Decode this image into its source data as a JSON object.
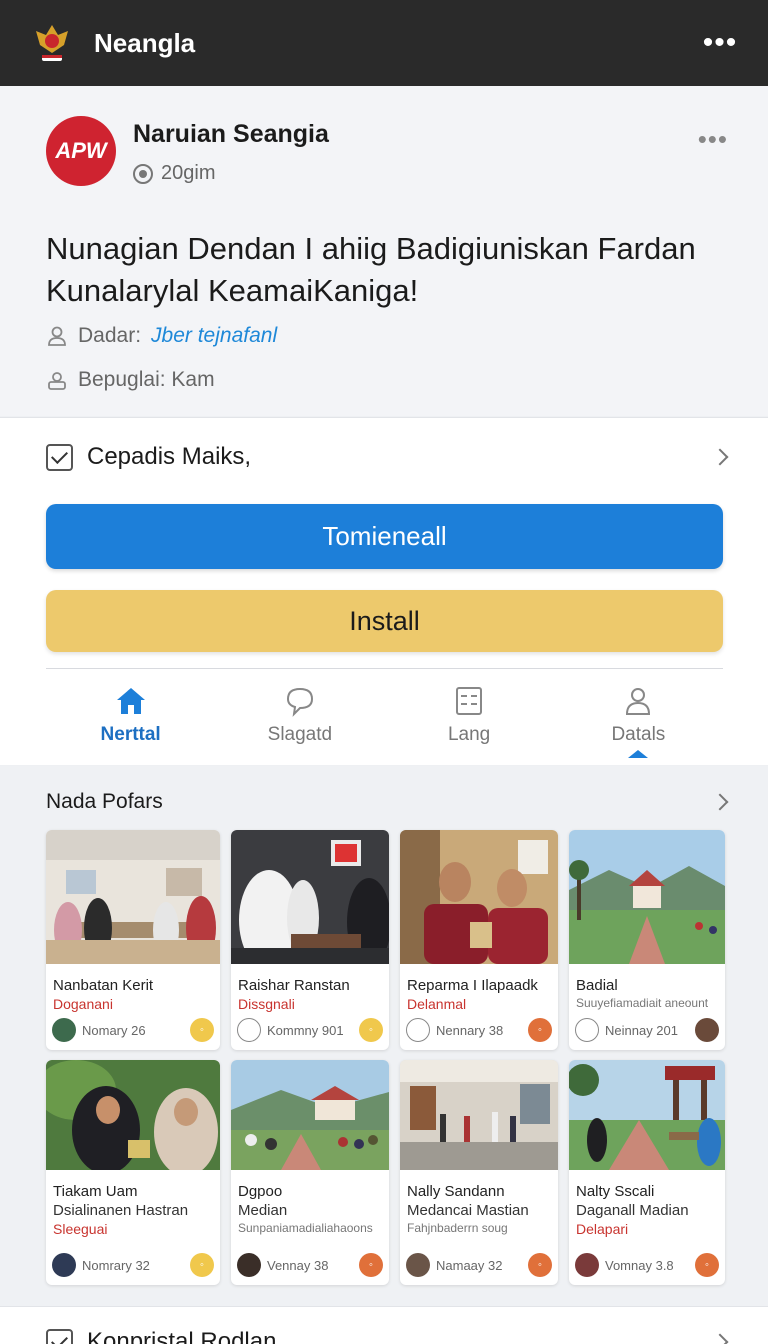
{
  "topbar": {
    "title": "Neangla",
    "more_icon": "more-horizontal-icon"
  },
  "post": {
    "badge": "APW",
    "author": "Naruian Seangia",
    "time": "20gim",
    "headline": "Nunagian Dendan I ahiig Badigiuniskan Fardan Kunalarylal KeamaiKaniga!",
    "meta1_label": "Dadar:",
    "meta1_link": "Jber tejnafanl",
    "meta2": "Bepuglai: Kam"
  },
  "actions": {
    "check_label": "Cepadis Maiks,",
    "primary_label": "Tomieneall",
    "secondary_label": "Install",
    "colors": {
      "primary": "#1d7fd9",
      "secondary": "#edc96c"
    }
  },
  "tabs": [
    {
      "label": "Nerttal",
      "icon": "home-icon",
      "active": true
    },
    {
      "label": "Slagatd",
      "icon": "chat-bubble-icon",
      "active": false
    },
    {
      "label": "Lang",
      "icon": "list-icon",
      "active": false
    },
    {
      "label": "Datals",
      "icon": "user-icon",
      "active": false
    }
  ],
  "gallery": {
    "title": "Nada Pofars",
    "cards": [
      {
        "title": "Nanbatan Kerit",
        "sub": "Doganani",
        "meta": "Nomary 26"
      },
      {
        "title": "Raishar Ranstan",
        "sub": "Dissgnali",
        "meta": "Kommny 901"
      },
      {
        "title": "Reparma I Ilapaadk",
        "sub": "Delanmal",
        "meta": "Nennary 38"
      },
      {
        "title": "Badial",
        "sub": "Suuyefiamadiait aneount",
        "meta": "Neinnay 201"
      },
      {
        "title": "Tiakam Uam",
        "sub2": "Dsialinanen Hastran",
        "sub": "Sleeguai",
        "meta": "Nomrary 32"
      },
      {
        "title": "Dgpoo",
        "sub2": "Median",
        "sub": "Sunpaniamadialiahaoons",
        "meta": "Vennay 38"
      },
      {
        "title": "Nally Sandann",
        "sub2": "Medancai Mastian",
        "sub": "Fahjnbaderrn soug",
        "meta": "Namaay 32"
      },
      {
        "title": "Nalty Sscali",
        "sub2": "Daganall Madian",
        "sub": "Delapari",
        "meta": "Vomnay 3.8"
      }
    ]
  },
  "bottom": {
    "check_label": "Konpristal Rodlan"
  }
}
